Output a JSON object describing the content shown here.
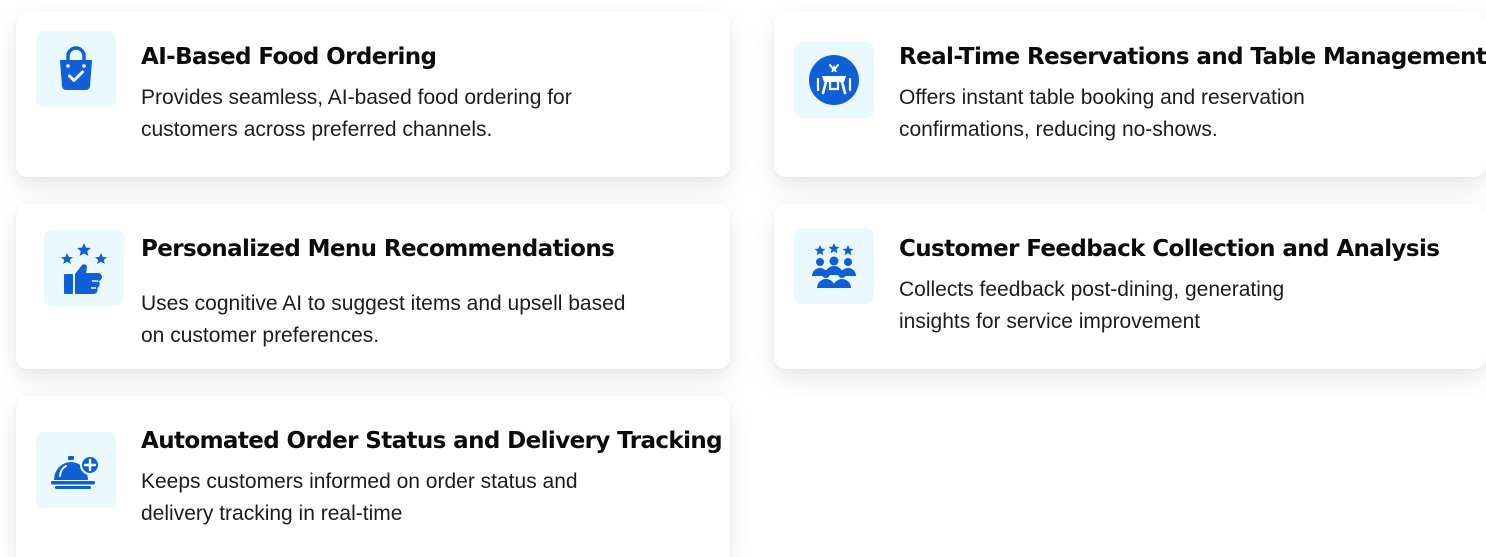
{
  "features": [
    {
      "title": "AI-Based Food Ordering",
      "description": "Provides seamless, AI-based food ordering for customers across preferred channels.",
      "icon": "shopping-bag-check-icon"
    },
    {
      "title": "Real-Time Reservations and Table Management",
      "description": "Offers instant table booking and reservation confirmations, reducing no-shows.",
      "icon": "dining-table-icon"
    },
    {
      "title": "Personalized Menu Recommendations",
      "description": "Uses cognitive AI to suggest items and upsell based on customer preferences.",
      "icon": "thumbs-up-stars-icon"
    },
    {
      "title": "Customer Feedback Collection and Analysis",
      "description": "Collects feedback post-dining, generating insights for service improvement",
      "icon": "group-stars-icon"
    },
    {
      "title": "Automated Order Status and Delivery Tracking",
      "description": "Keeps customers informed on order status and delivery tracking in real-time",
      "icon": "food-cloche-plus-icon"
    }
  ],
  "colors": {
    "icon_blue": "#0f5fd7",
    "icon_background": "#eaf9fd",
    "title_text": "#0b0b0b",
    "body_text": "#1c1c1c"
  }
}
